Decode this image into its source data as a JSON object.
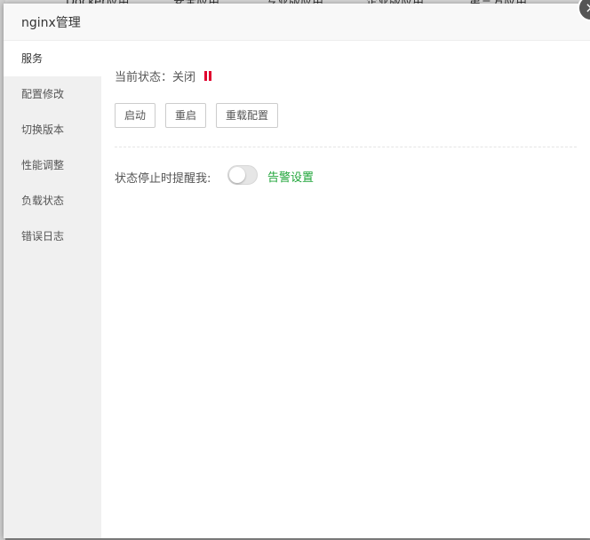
{
  "background": {
    "tabs": [
      "Docker应用",
      "安全应用",
      "专业版应用",
      "企业版应用",
      "第三方应用"
    ]
  },
  "modal": {
    "title": "nginx管理",
    "close_label": "×"
  },
  "sidebar": {
    "items": [
      {
        "label": "服务",
        "active": true
      },
      {
        "label": "配置修改",
        "active": false
      },
      {
        "label": "切换版本",
        "active": false
      },
      {
        "label": "性能调整",
        "active": false
      },
      {
        "label": "负载状态",
        "active": false
      },
      {
        "label": "错误日志",
        "active": false
      }
    ]
  },
  "service": {
    "status_label": "当前状态：",
    "status_value": "关闭",
    "status_color": "#e0002d",
    "buttons": {
      "start": "启动",
      "restart": "重启",
      "reload": "重载配置"
    },
    "alert": {
      "label": "状态停止时提醒我:",
      "enabled": false,
      "link": "告警设置",
      "link_color": "#20a53a"
    }
  }
}
